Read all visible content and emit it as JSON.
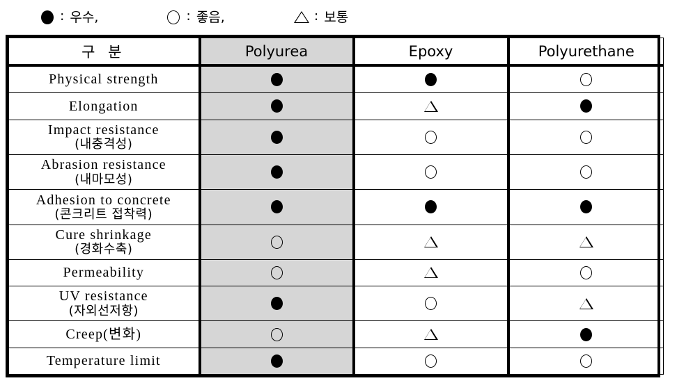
{
  "legend": {
    "items": [
      {
        "symbol": "filled-circle",
        "separator": ":",
        "label": "우수,"
      },
      {
        "symbol": "open-circle",
        "separator": ":",
        "label": "좋음,"
      },
      {
        "symbol": "triangle",
        "separator": ":",
        "label": "보통"
      }
    ]
  },
  "table": {
    "headers": [
      "구 분",
      "Polyurea",
      "Epoxy",
      "Polyurethane"
    ],
    "shaded_column": "Polyurea",
    "shaded_color": "#d6d6d6",
    "rows": [
      {
        "en": "Physical strength",
        "ko": "",
        "polyurea": "filled-circle",
        "epoxy": "filled-circle",
        "polyurethane": "open-circle"
      },
      {
        "en": "Elongation",
        "ko": "",
        "polyurea": "filled-circle",
        "epoxy": "triangle",
        "polyurethane": "filled-circle"
      },
      {
        "en": "Impact resistance",
        "ko": "(내충격성)",
        "polyurea": "filled-circle",
        "epoxy": "open-circle",
        "polyurethane": "open-circle"
      },
      {
        "en": "Abrasion resistance",
        "ko": "(내마모성)",
        "polyurea": "filled-circle",
        "epoxy": "open-circle",
        "polyurethane": "open-circle"
      },
      {
        "en": "Adhesion to concrete",
        "ko": "(콘크리트 접착력)",
        "polyurea": "filled-circle",
        "epoxy": "filled-circle",
        "polyurethane": "filled-circle"
      },
      {
        "en": "Cure shrinkage",
        "ko": "(경화수축)",
        "polyurea": "open-circle",
        "epoxy": "triangle",
        "polyurethane": "triangle"
      },
      {
        "en": "Permeability",
        "ko": "",
        "polyurea": "open-circle",
        "epoxy": "triangle",
        "polyurethane": "open-circle"
      },
      {
        "en": "UV resistance",
        "ko": "(자외선저항)",
        "polyurea": "filled-circle",
        "epoxy": "open-circle",
        "polyurethane": "triangle"
      },
      {
        "en": "Creep(변화)",
        "ko": "",
        "polyurea": "open-circle",
        "epoxy": "triangle",
        "polyurethane": "filled-circle"
      },
      {
        "en": "Temperature limit",
        "ko": "",
        "polyurea": "filled-circle",
        "epoxy": "open-circle",
        "polyurethane": "open-circle"
      }
    ]
  }
}
